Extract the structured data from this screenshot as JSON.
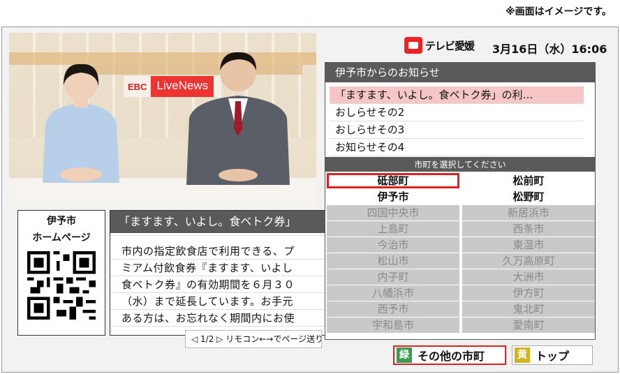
{
  "disclaimer": "※画面はイメージです。",
  "video": {
    "logo_ebc": "EBC",
    "logo_live": "LiveNews"
  },
  "header": {
    "channel": "テレビ愛媛",
    "datetime": "3月16日（水）16:06"
  },
  "qr_panel": {
    "line1": "伊予市",
    "line2": "ホームページ"
  },
  "article": {
    "title": "「ますます、いよし。食ベトク券」",
    "lines": [
      "市内の指定飲食店で利用できる、プ",
      "ミアム付飲食券『ますます、いよし",
      "食ベトク券』の有効期間を６月３０",
      "（水）まで延長しています。お手元",
      "ある方は、お忘れなく期間内にお使"
    ],
    "pager": "◁ 1/2 ▷ リモコン←→でページ送り"
  },
  "notices": {
    "title": "伊予市からのお知らせ",
    "items": [
      "「ますます、いよし。食ベトク券」の利…",
      "おしらせその2",
      "おしらせその3",
      "お知らせその4"
    ]
  },
  "town_selector": {
    "title": "市町を選択してください",
    "towns": [
      {
        "name": "砥部町",
        "active": true
      },
      {
        "name": "松前町",
        "active": true
      },
      {
        "name": "伊予市",
        "active": true
      },
      {
        "name": "松野町",
        "active": true
      },
      {
        "name": "四国中央市",
        "active": false
      },
      {
        "name": "新居浜市",
        "active": false
      },
      {
        "name": "上島町",
        "active": false
      },
      {
        "name": "西条市",
        "active": false
      },
      {
        "name": "今治市",
        "active": false
      },
      {
        "name": "東温市",
        "active": false
      },
      {
        "name": "松山市",
        "active": false
      },
      {
        "name": "久万高原町",
        "active": false
      },
      {
        "name": "内子町",
        "active": false
      },
      {
        "name": "大洲市",
        "active": false
      },
      {
        "name": "八幡浜市",
        "active": false
      },
      {
        "name": "伊方町",
        "active": false
      },
      {
        "name": "西予市",
        "active": false
      },
      {
        "name": "鬼北町",
        "active": false
      },
      {
        "name": "宇和島市",
        "active": false
      },
      {
        "name": "愛南町",
        "active": false
      }
    ]
  },
  "buttons": {
    "green_key": "緑",
    "green_label": "その他の市町",
    "yellow_key": "黄",
    "yellow_label": "トップ"
  },
  "colors": {
    "focus": "#e02020",
    "selected_notice": "#f6c6c6",
    "green_key": "#3c9a55",
    "yellow_key": "#d6b21c"
  }
}
